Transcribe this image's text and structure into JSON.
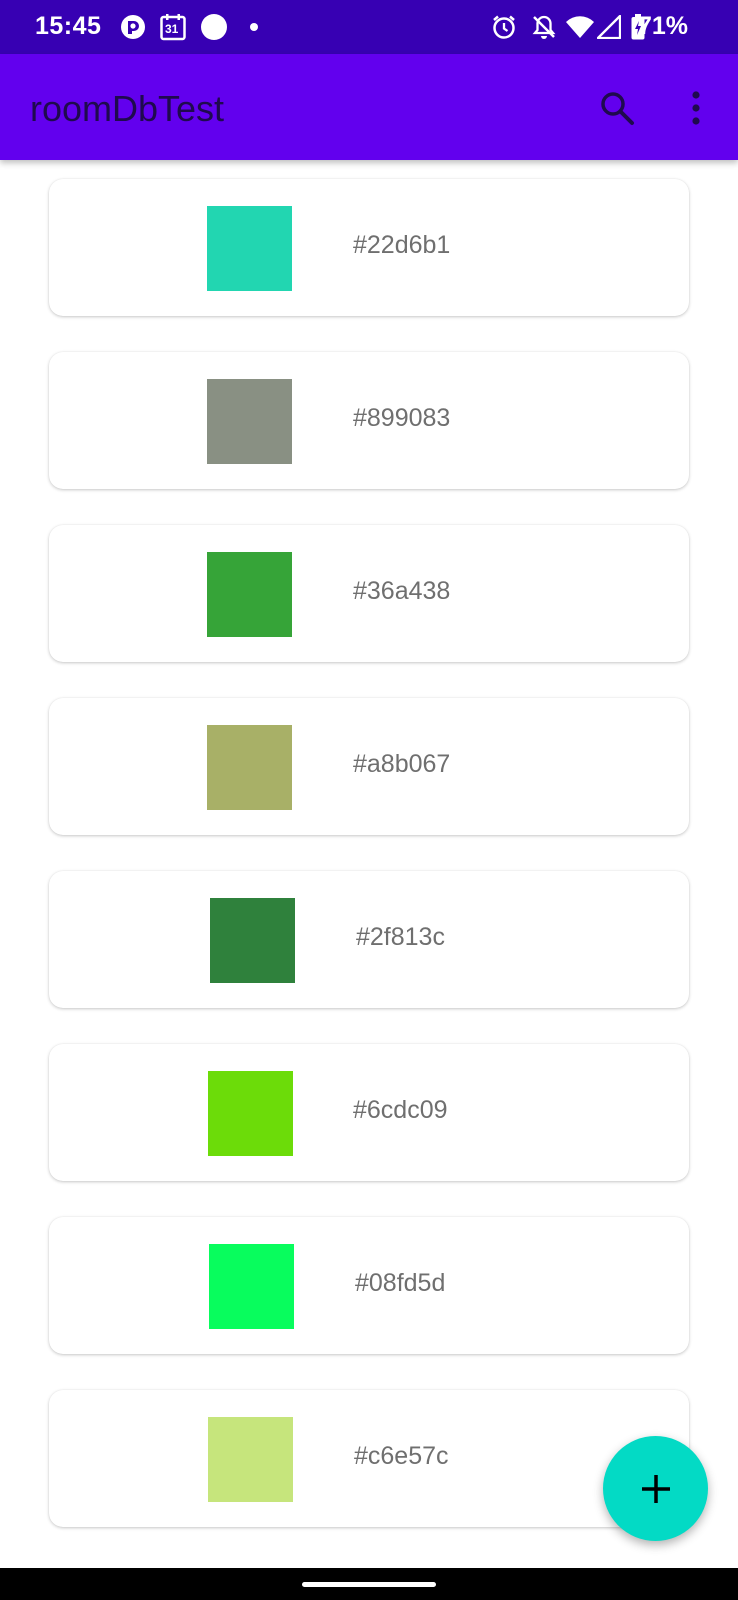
{
  "status_bar": {
    "time": "15:45",
    "battery_text": "71%",
    "calendar_day": "31",
    "icons": [
      "pocket-casts-icon",
      "calendar-icon",
      "circle-dot-icon",
      "small-dot-icon",
      "alarm-icon",
      "notifications-off-icon",
      "wifi-icon",
      "cell-signal-icon",
      "battery-charging-icon"
    ]
  },
  "app_bar": {
    "title": "roomDbTest",
    "actions": [
      "search-icon",
      "overflow-menu-icon"
    ]
  },
  "colors": [
    {
      "hex": "#22d6b1",
      "label": "#22d6b1"
    },
    {
      "hex": "#899083",
      "label": "#899083"
    },
    {
      "hex": "#36a438",
      "label": "#36a438"
    },
    {
      "hex": "#a8b067",
      "label": "#a8b067"
    },
    {
      "hex": "#2f813c",
      "label": "#2f813c"
    },
    {
      "hex": "#6cdc09",
      "label": "#6cdc09"
    },
    {
      "hex": "#08fd5d",
      "label": "#08fd5d"
    },
    {
      "hex": "#c6e57c",
      "label": "#c6e57c"
    }
  ],
  "fab": {
    "icon": "add-icon"
  },
  "theme": {
    "status_bar_color": "#3700b3",
    "app_bar_color": "#6200ee",
    "fab_color": "#03dac5"
  }
}
